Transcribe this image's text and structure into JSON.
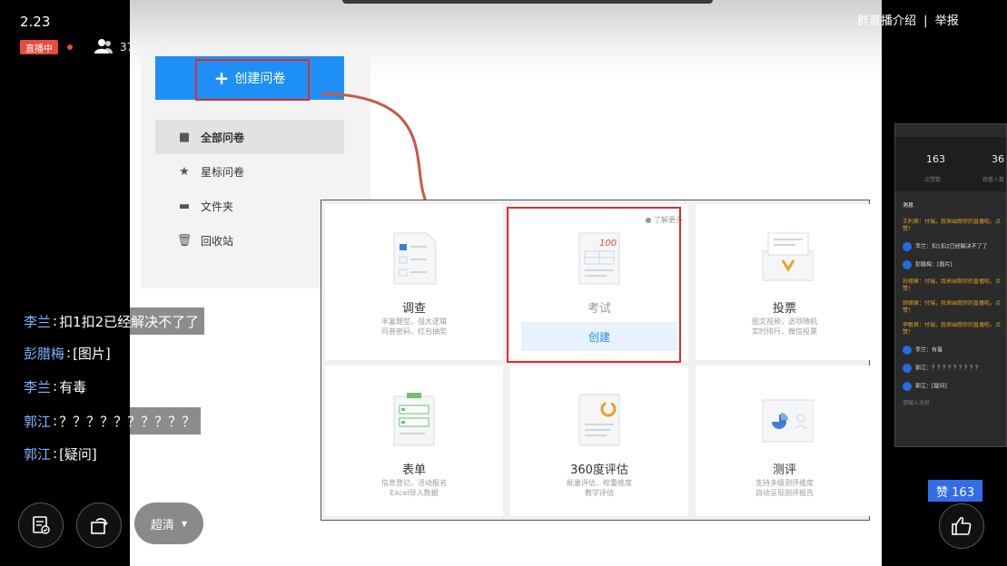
{
  "header": {
    "time": "2.23",
    "live_badge": "直播中",
    "viewers": "37 人观看",
    "group_intro": "群直播介绍",
    "divider": "|",
    "report": "举报"
  },
  "slide": {
    "create_button": "创建问卷",
    "nav_items": [
      {
        "label": "全部问卷",
        "icon": "file-icon"
      },
      {
        "label": "星标问卷",
        "icon": "star-icon"
      },
      {
        "label": "文件夹",
        "icon": "folder-icon"
      },
      {
        "label": "回收站",
        "icon": "trash-icon"
      }
    ],
    "learn_more": "了解更多",
    "cards": [
      {
        "title": "调查",
        "desc1": "丰富题型，强大逻辑",
        "desc2": "问卷密码，红包抽奖"
      },
      {
        "title": "考试",
        "create": "创建"
      },
      {
        "title": "投票",
        "desc1": "图文视频，选项随机",
        "desc2": "实时排行，微信投票"
      },
      {
        "title": "表单",
        "desc1": "信息登记，活动报名",
        "desc2": "Excel导入数据"
      },
      {
        "title": "360度评估",
        "desc1": "批量评估，权重维度",
        "desc2": "教学评估"
      },
      {
        "title": "测评",
        "desc1": "支持多级测评维度",
        "desc2": "自动呈现测评报告"
      }
    ]
  },
  "chat": [
    {
      "user": "李兰",
      "message": "扣1扣2已经解决不了了"
    },
    {
      "user": "彭腊梅",
      "message": "[图片]"
    },
    {
      "user": "李兰",
      "message": "有毒"
    },
    {
      "user": "郭江",
      "message": "？？？？？？？？？？"
    },
    {
      "user": "郭江",
      "message": "[疑问]"
    }
  ],
  "chat_separator": ":",
  "controls": {
    "quality": "超清"
  },
  "side_panel": {
    "stat1_num": "163",
    "stat1_lbl": "点赞数",
    "stat2_num": "36",
    "stat2_lbl": "观看人数",
    "section": "消息",
    "msg1": "王利君：付瑞，我来围观你的直播啦，点赞！",
    "msg2": "李兰：扣1扣2已经解决不了了",
    "msg3": "彭腊梅：[图片]",
    "msg4": "孙德章：付瑞，我来围观你的直播啦，点赞！",
    "msg5": "胡德章：付瑞，我来围观你的直播啦，点赞！",
    "msg6": "李敏君：付瑞，我来围观你的直播啦，点赞！",
    "msg7": "李兰：有毒",
    "msg8": "郭江：？？？？？？？？？",
    "msg9": "郭江：[疑问]",
    "input": "请输入消息"
  },
  "like": {
    "label": "赞 163"
  },
  "colors": {
    "accent_blue": "#1e8ff5",
    "highlight_red": "#d9302a",
    "live_red": "#e84c3d",
    "chat_user": "#7fb3ff"
  }
}
